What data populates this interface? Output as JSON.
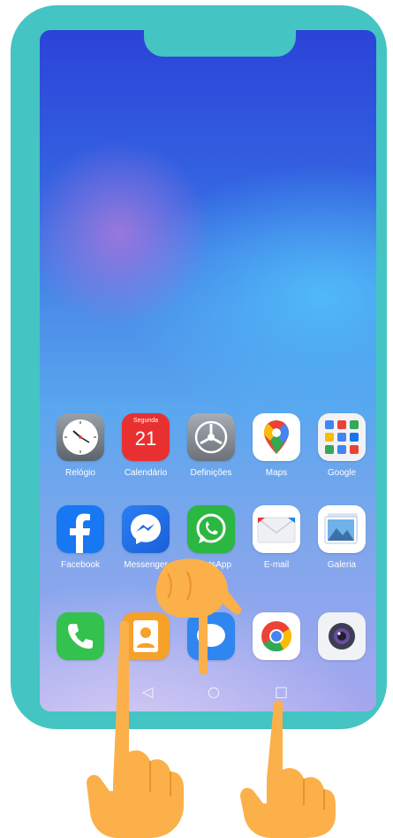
{
  "home_screen": {
    "row1": [
      {
        "label": "Relógio",
        "icon": "clock-icon"
      },
      {
        "label": "Calendário",
        "icon": "calendar-icon",
        "day": "Segunda",
        "date": "21"
      },
      {
        "label": "Definições",
        "icon": "settings-icon"
      },
      {
        "label": "Maps",
        "icon": "maps-icon"
      },
      {
        "label": "Google",
        "icon": "google-folder-icon"
      }
    ],
    "row2": [
      {
        "label": "Facebook",
        "icon": "facebook-icon"
      },
      {
        "label": "Messenger",
        "icon": "messenger-icon"
      },
      {
        "label": "WhatsApp",
        "icon": "whatsapp-icon"
      },
      {
        "label": "E-mail",
        "icon": "email-icon"
      },
      {
        "label": "Galeria",
        "icon": "gallery-icon"
      }
    ],
    "dock": [
      {
        "icon": "phone-icon"
      },
      {
        "icon": "contacts-icon"
      },
      {
        "icon": "messages-icon"
      },
      {
        "icon": "chrome-icon"
      },
      {
        "icon": "camera-icon"
      }
    ]
  },
  "nav_bar": {
    "back": "◁",
    "home": "○",
    "recents": "□"
  },
  "colors": {
    "phone_frame": "#44c4c2",
    "hand": "#fbb04a",
    "whatsapp": "#2bb741",
    "facebook": "#1877f2"
  }
}
